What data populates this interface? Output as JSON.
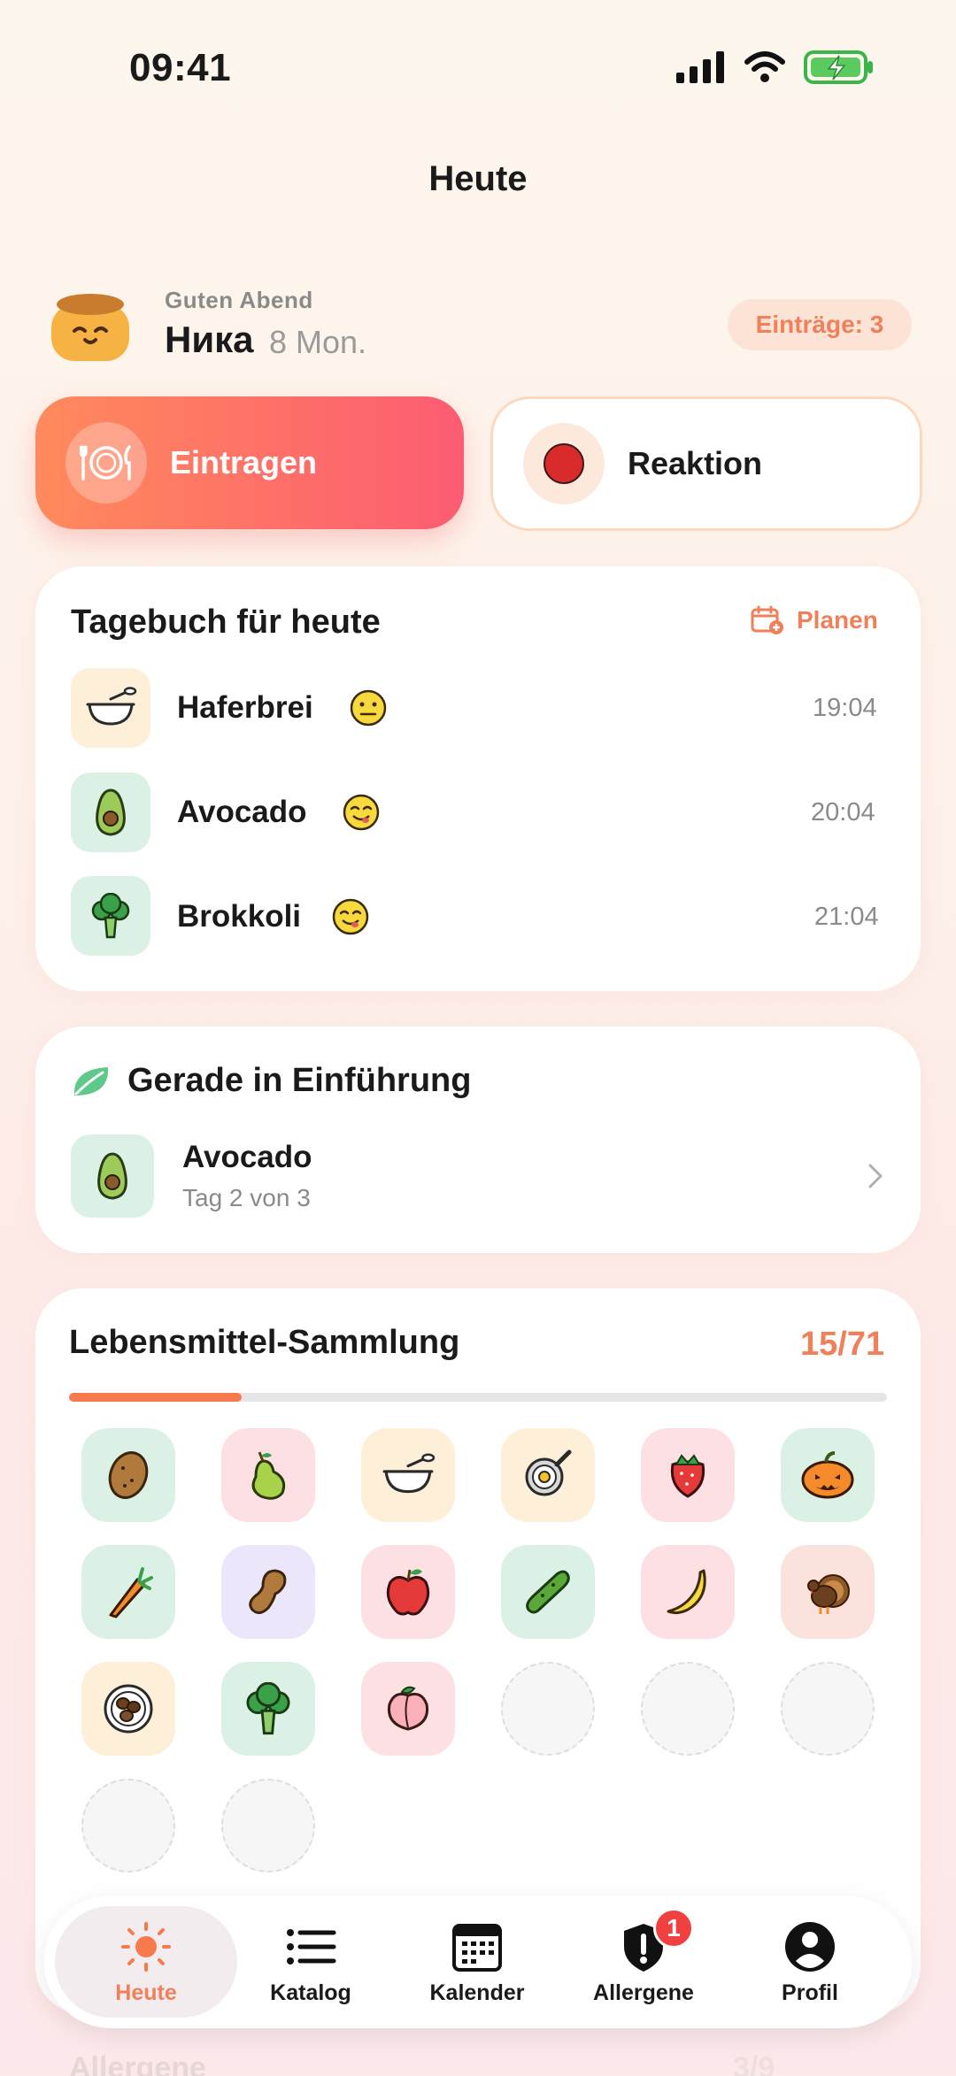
{
  "status": {
    "time": "09:41"
  },
  "header": {
    "title": "Heute"
  },
  "greeting": {
    "salutation": "Guten Abend",
    "name": "Ника",
    "age": "8 Mon.",
    "entries": "Einträge: 3"
  },
  "actions": {
    "log_label": "Eintragen",
    "reaction_label": "Reaktion"
  },
  "diary": {
    "title": "Tagebuch für heute",
    "plan_label": "Planen",
    "entries": [
      {
        "name": "Haferbrei",
        "time": "19:04",
        "icon": "bowl-icon",
        "mood": "neutral-face-icon"
      },
      {
        "name": "Avocado",
        "time": "20:04",
        "icon": "avocado-icon",
        "mood": "yum-face-icon"
      },
      {
        "name": "Brokkoli",
        "time": "21:04",
        "icon": "broccoli-icon",
        "mood": "yum-face-icon"
      }
    ]
  },
  "introduction": {
    "title": "Gerade in Einführung",
    "food": "Avocado",
    "progress": "Tag 2 von 3"
  },
  "collection": {
    "title": "Lebensmittel-Sammlung",
    "count": "15/71",
    "progress": 0.211,
    "items": [
      "potato-icon",
      "pear-icon",
      "porridge-icon",
      "fried-egg-icon",
      "strawberry-icon",
      "pumpkin-icon",
      "carrot-icon",
      "peanut-icon",
      "apple-icon",
      "cucumber-icon",
      "banana-icon",
      "turkey-icon",
      "beans-icon",
      "broccoli-icon",
      "peach-icon"
    ],
    "empty_slots": 5
  },
  "nav": {
    "items": [
      {
        "label": "Heute",
        "icon": "sun-icon",
        "active": true
      },
      {
        "label": "Katalog",
        "icon": "list-icon"
      },
      {
        "label": "Kalender",
        "icon": "calendar-icon"
      },
      {
        "label": "Allergene",
        "icon": "shield-alert-icon",
        "badge": "1"
      },
      {
        "label": "Profil",
        "icon": "profile-icon"
      }
    ]
  },
  "peek": {
    "label": "Allergene",
    "count": "3/9"
  },
  "colors": {
    "accent": "#f0805a",
    "primary_gradient_start": "#ff8a5c",
    "primary_gradient_end": "#fc5c72"
  }
}
